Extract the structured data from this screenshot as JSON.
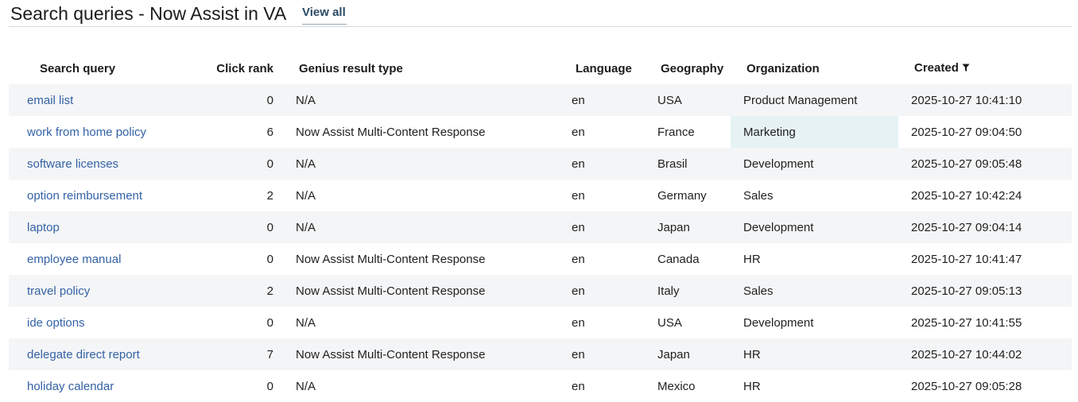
{
  "header": {
    "title": "Search queries - Now Assist in VA",
    "view_all": "View all"
  },
  "table": {
    "columns": [
      "Search query",
      "Click rank",
      "Genius result type",
      "Language",
      "Geography",
      "Organization",
      "Created"
    ],
    "sort_icon": "filter-icon",
    "rows": [
      {
        "query": "email list",
        "rank": "0",
        "genius": "N/A",
        "lang": "en",
        "geo": "USA",
        "org": "Product Management",
        "created": "2025-10-27 10:41:10"
      },
      {
        "query": "work from home policy",
        "rank": "6",
        "genius": "Now Assist Multi-Content Response",
        "lang": "en",
        "geo": "France",
        "org": "Marketing",
        "created": "2025-10-27 09:04:50"
      },
      {
        "query": "software licenses",
        "rank": "0",
        "genius": "N/A",
        "lang": "en",
        "geo": "Brasil",
        "org": "Development",
        "created": "2025-10-27 09:05:48"
      },
      {
        "query": "option reimbursement",
        "rank": "2",
        "genius": "N/A",
        "lang": "en",
        "geo": "Germany",
        "org": "Sales",
        "created": "2025-10-27 10:42:24"
      },
      {
        "query": "laptop",
        "rank": "0",
        "genius": "N/A",
        "lang": "en",
        "geo": "Japan",
        "org": "Development",
        "created": "2025-10-27 09:04:14"
      },
      {
        "query": "employee manual",
        "rank": "0",
        "genius": "Now Assist Multi-Content Response",
        "lang": "en",
        "geo": "Canada",
        "org": "HR",
        "created": "2025-10-27 10:41:47"
      },
      {
        "query": "travel policy",
        "rank": "2",
        "genius": "Now Assist Multi-Content Response",
        "lang": "en",
        "geo": "Italy",
        "org": "Sales",
        "created": "2025-10-27 09:05:13"
      },
      {
        "query": "ide options",
        "rank": "0",
        "genius": "N/A",
        "lang": "en",
        "geo": "USA",
        "org": "Development",
        "created": "2025-10-27 10:41:55"
      },
      {
        "query": "delegate direct report",
        "rank": "7",
        "genius": "Now Assist Multi-Content Response",
        "lang": "en",
        "geo": "Japan",
        "org": "HR",
        "created": "2025-10-27 10:44:02"
      },
      {
        "query": "holiday calendar",
        "rank": "0",
        "genius": "N/A",
        "lang": "en",
        "geo": "Mexico",
        "org": "HR",
        "created": "2025-10-27 09:05:28"
      }
    ]
  },
  "colors": {
    "link": "#3462a6",
    "view_all": "#2b4a66",
    "row_stripe": "#f4f5f6",
    "cell_highlight": "#e6f2f4"
  }
}
